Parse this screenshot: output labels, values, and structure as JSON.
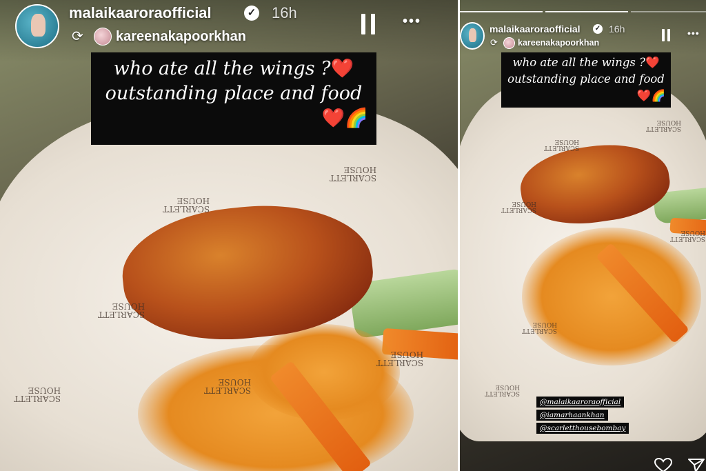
{
  "left_story": {
    "username": "malaikaaroraofficial",
    "time": "16h",
    "reposter": "kareenakapoorkhan",
    "caption_line1": "who ate all the wings ?",
    "caption_line2": "outstanding place and food",
    "caption_emojis": "❤️🌈",
    "heart_emoji": "❤️",
    "verified_mark": "✓",
    "pause_icon": "pause-icon",
    "more_icon": "more-icon",
    "more_glyph": "•••",
    "repost_glyph": "⟳"
  },
  "right_story": {
    "username": "malaikaaroraofficial",
    "time": "16h",
    "reposter": "kareenakapoorkhan",
    "caption_line1": "who ate all the wings ?",
    "caption_line2": "outstanding place and food",
    "caption_emojis": "❤️🌈",
    "heart_emoji": "❤️",
    "verified_mark": "✓",
    "more_glyph": "•••",
    "repost_glyph": "⟳",
    "mentions": [
      "@malaikaaroraofficial",
      "@iamarhaankhan",
      "@scarletthousebombay"
    ],
    "like_icon": "heart-outline-icon",
    "share_icon": "send-icon"
  },
  "paper_print": "SCARLETT\nHOUSE",
  "colors": {
    "sauce": "#e58a20",
    "wing": "#a8471a",
    "paper": "#efe9e0",
    "caption_bg": "#0b0b0b"
  }
}
